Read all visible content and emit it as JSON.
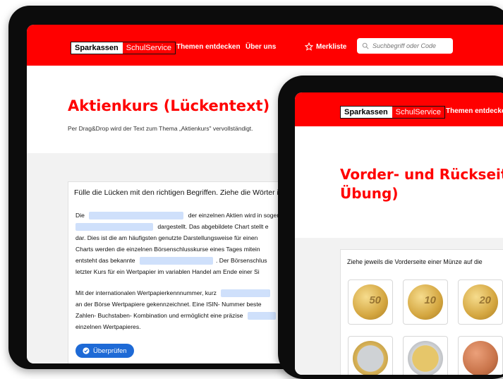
{
  "colors": {
    "brand_red": "#ff0000",
    "button_blue": "#1e6ad6",
    "gap_blue": "#cfe0fb",
    "coin_gold": "#d4a640",
    "coin_copper": "#c9744a"
  },
  "brand": {
    "part1": "Sparkassen",
    "part2": "SchulService"
  },
  "nav": {
    "themen": "Themen entdecken",
    "ueber": "Über uns",
    "merkliste": "Merkliste",
    "search_placeholder": "Suchbegriff oder Code"
  },
  "back": {
    "title": "Aktienkurs (Lückentext)",
    "subtitle": "Per Drag&Drop wird der Text zum Thema „Aktienkurs\" vervollständigt.",
    "instruction": "Fülle die Lücken mit den richtigen Begriffen. Ziehe die Wörter in",
    "text": {
      "l1a": "Die",
      "l1b": "der einzelnen Aktien wird in sogenann",
      "l2b": "dargestellt. Das abgebildete Chart stellt e",
      "l3": "dar. Dies ist die am häufigsten genutzte Darstellungsweise für einen",
      "l4": "Charts werden die einzelnen Börsenschlusskurse eines Tages mitein",
      "l5a": "entsteht das bekannte",
      "l5b": ". Der Börsenschlus",
      "l6": "letzter Kurs für ein Wertpapier im variablen Handel am Ende einer Si",
      "l7a": "Mit der internationalen Wertpapierkennnummer, kurz",
      "l8": "an der Börse Wertpapiere gekennzeichnet. Eine ISIN- Nummer beste",
      "l9a": "Zahlen- Buchstaben- Kombination und ermöglicht eine präzise",
      "l10": "einzelnen Wertpapieres."
    },
    "check_button": "Überprüfen"
  },
  "front": {
    "title_line1": "Vorder- und Rückseite (",
    "title_line2": "Übung)",
    "instruction": "Ziehe jeweils die Vorderseite einer Münze auf die",
    "coins": [
      {
        "label": "50",
        "type": "gold"
      },
      {
        "label": "10",
        "type": "gold"
      },
      {
        "label": "20",
        "type": "gold"
      },
      {
        "label": "",
        "type": "bimetal-gold"
      },
      {
        "label": "",
        "type": "bimetal-silver"
      },
      {
        "label": "",
        "type": "copper"
      }
    ]
  }
}
